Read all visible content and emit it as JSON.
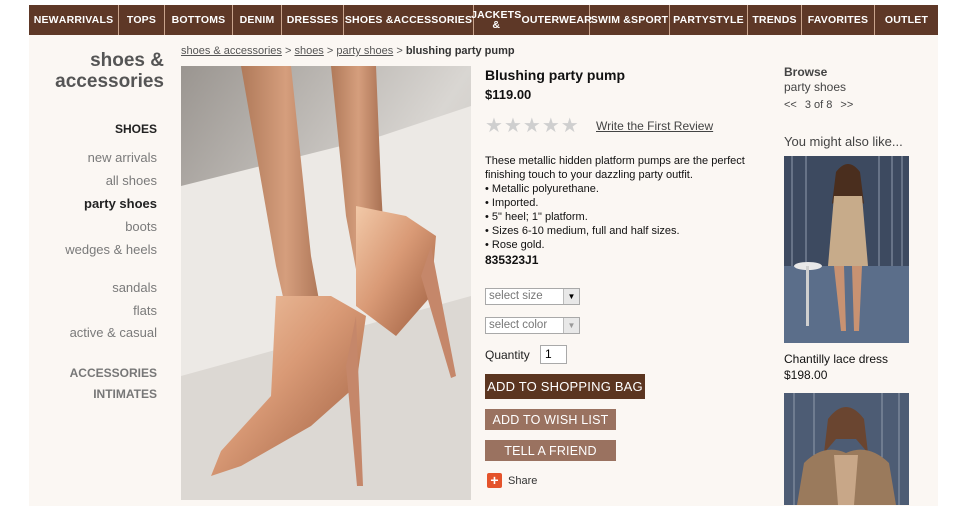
{
  "nav": [
    {
      "label": "NEW ARRIVALS",
      "width": 90
    },
    {
      "label": "TOPS",
      "width": 46
    },
    {
      "label": "BOTTOMS",
      "width": 68
    },
    {
      "label": "DENIM",
      "width": 49
    },
    {
      "label": "DRESSES",
      "width": 62
    },
    {
      "label": "SHOES & ACCESSORIES",
      "width": 130
    },
    {
      "label": "JACKETS & OUTERWEAR",
      "width": 116
    },
    {
      "label": "SWIM & SPORT",
      "width": 80
    },
    {
      "label": "PARTY STYLE",
      "width": 78
    },
    {
      "label": "TRENDS",
      "width": 54
    },
    {
      "label": "FAVORITES",
      "width": 73
    },
    {
      "label": "OUTLET",
      "width": 63
    }
  ],
  "sidebar": {
    "title": "shoes & accessories",
    "heading": "SHOES",
    "items": [
      {
        "label": "new arrivals"
      },
      {
        "label": "all shoes"
      },
      {
        "label": "party shoes",
        "active": true
      },
      {
        "label": "boots"
      },
      {
        "label": "wedges & heels"
      },
      {
        "label": "sandals"
      },
      {
        "label": "flats"
      },
      {
        "label": "active & casual"
      }
    ],
    "sections": [
      "ACCESSORIES",
      "INTIMATES"
    ]
  },
  "breadcrumb": {
    "links": [
      "shoes & accessories",
      "shoes",
      "party shoes"
    ],
    "separator": ">",
    "current": "blushing party pump"
  },
  "product": {
    "title": "Blushing party pump",
    "price": "$119.00",
    "rating_max": 5,
    "review_link": "Write the First Review",
    "description": "These metallic hidden platform pumps are the perfect finishing touch to your dazzling party outfit.",
    "bullets": [
      "• Metallic polyurethane.",
      "• Imported.",
      "• 5\" heel; 1\" platform.",
      "• Sizes 6-10 medium, full and half sizes.",
      "• Rose gold."
    ],
    "sku": "835323J1"
  },
  "purchase": {
    "size_placeholder": "select size",
    "color_placeholder": "select color",
    "quantity_label": "Quantity",
    "quantity_value": "1",
    "add_to_bag": "ADD TO SHOPPING BAG",
    "add_to_wishlist": "ADD TO WISH LIST",
    "tell_friend": "TELL A FRIEND",
    "share": "Share"
  },
  "browse": {
    "title": "Browse",
    "category": "party shoes",
    "prev": "<<",
    "position": "3 of 8",
    "next": ">>"
  },
  "recommendations": {
    "title": "You might also like...",
    "items": [
      {
        "name": "Chantilly lace dress",
        "price": "$198.00"
      },
      {
        "name": "",
        "price": ""
      }
    ]
  },
  "colors": {
    "nav_bg": "#5e3827",
    "button_primary": "#5b3520",
    "button_secondary": "#9a7260",
    "page_bg": "#fbf7f3"
  }
}
